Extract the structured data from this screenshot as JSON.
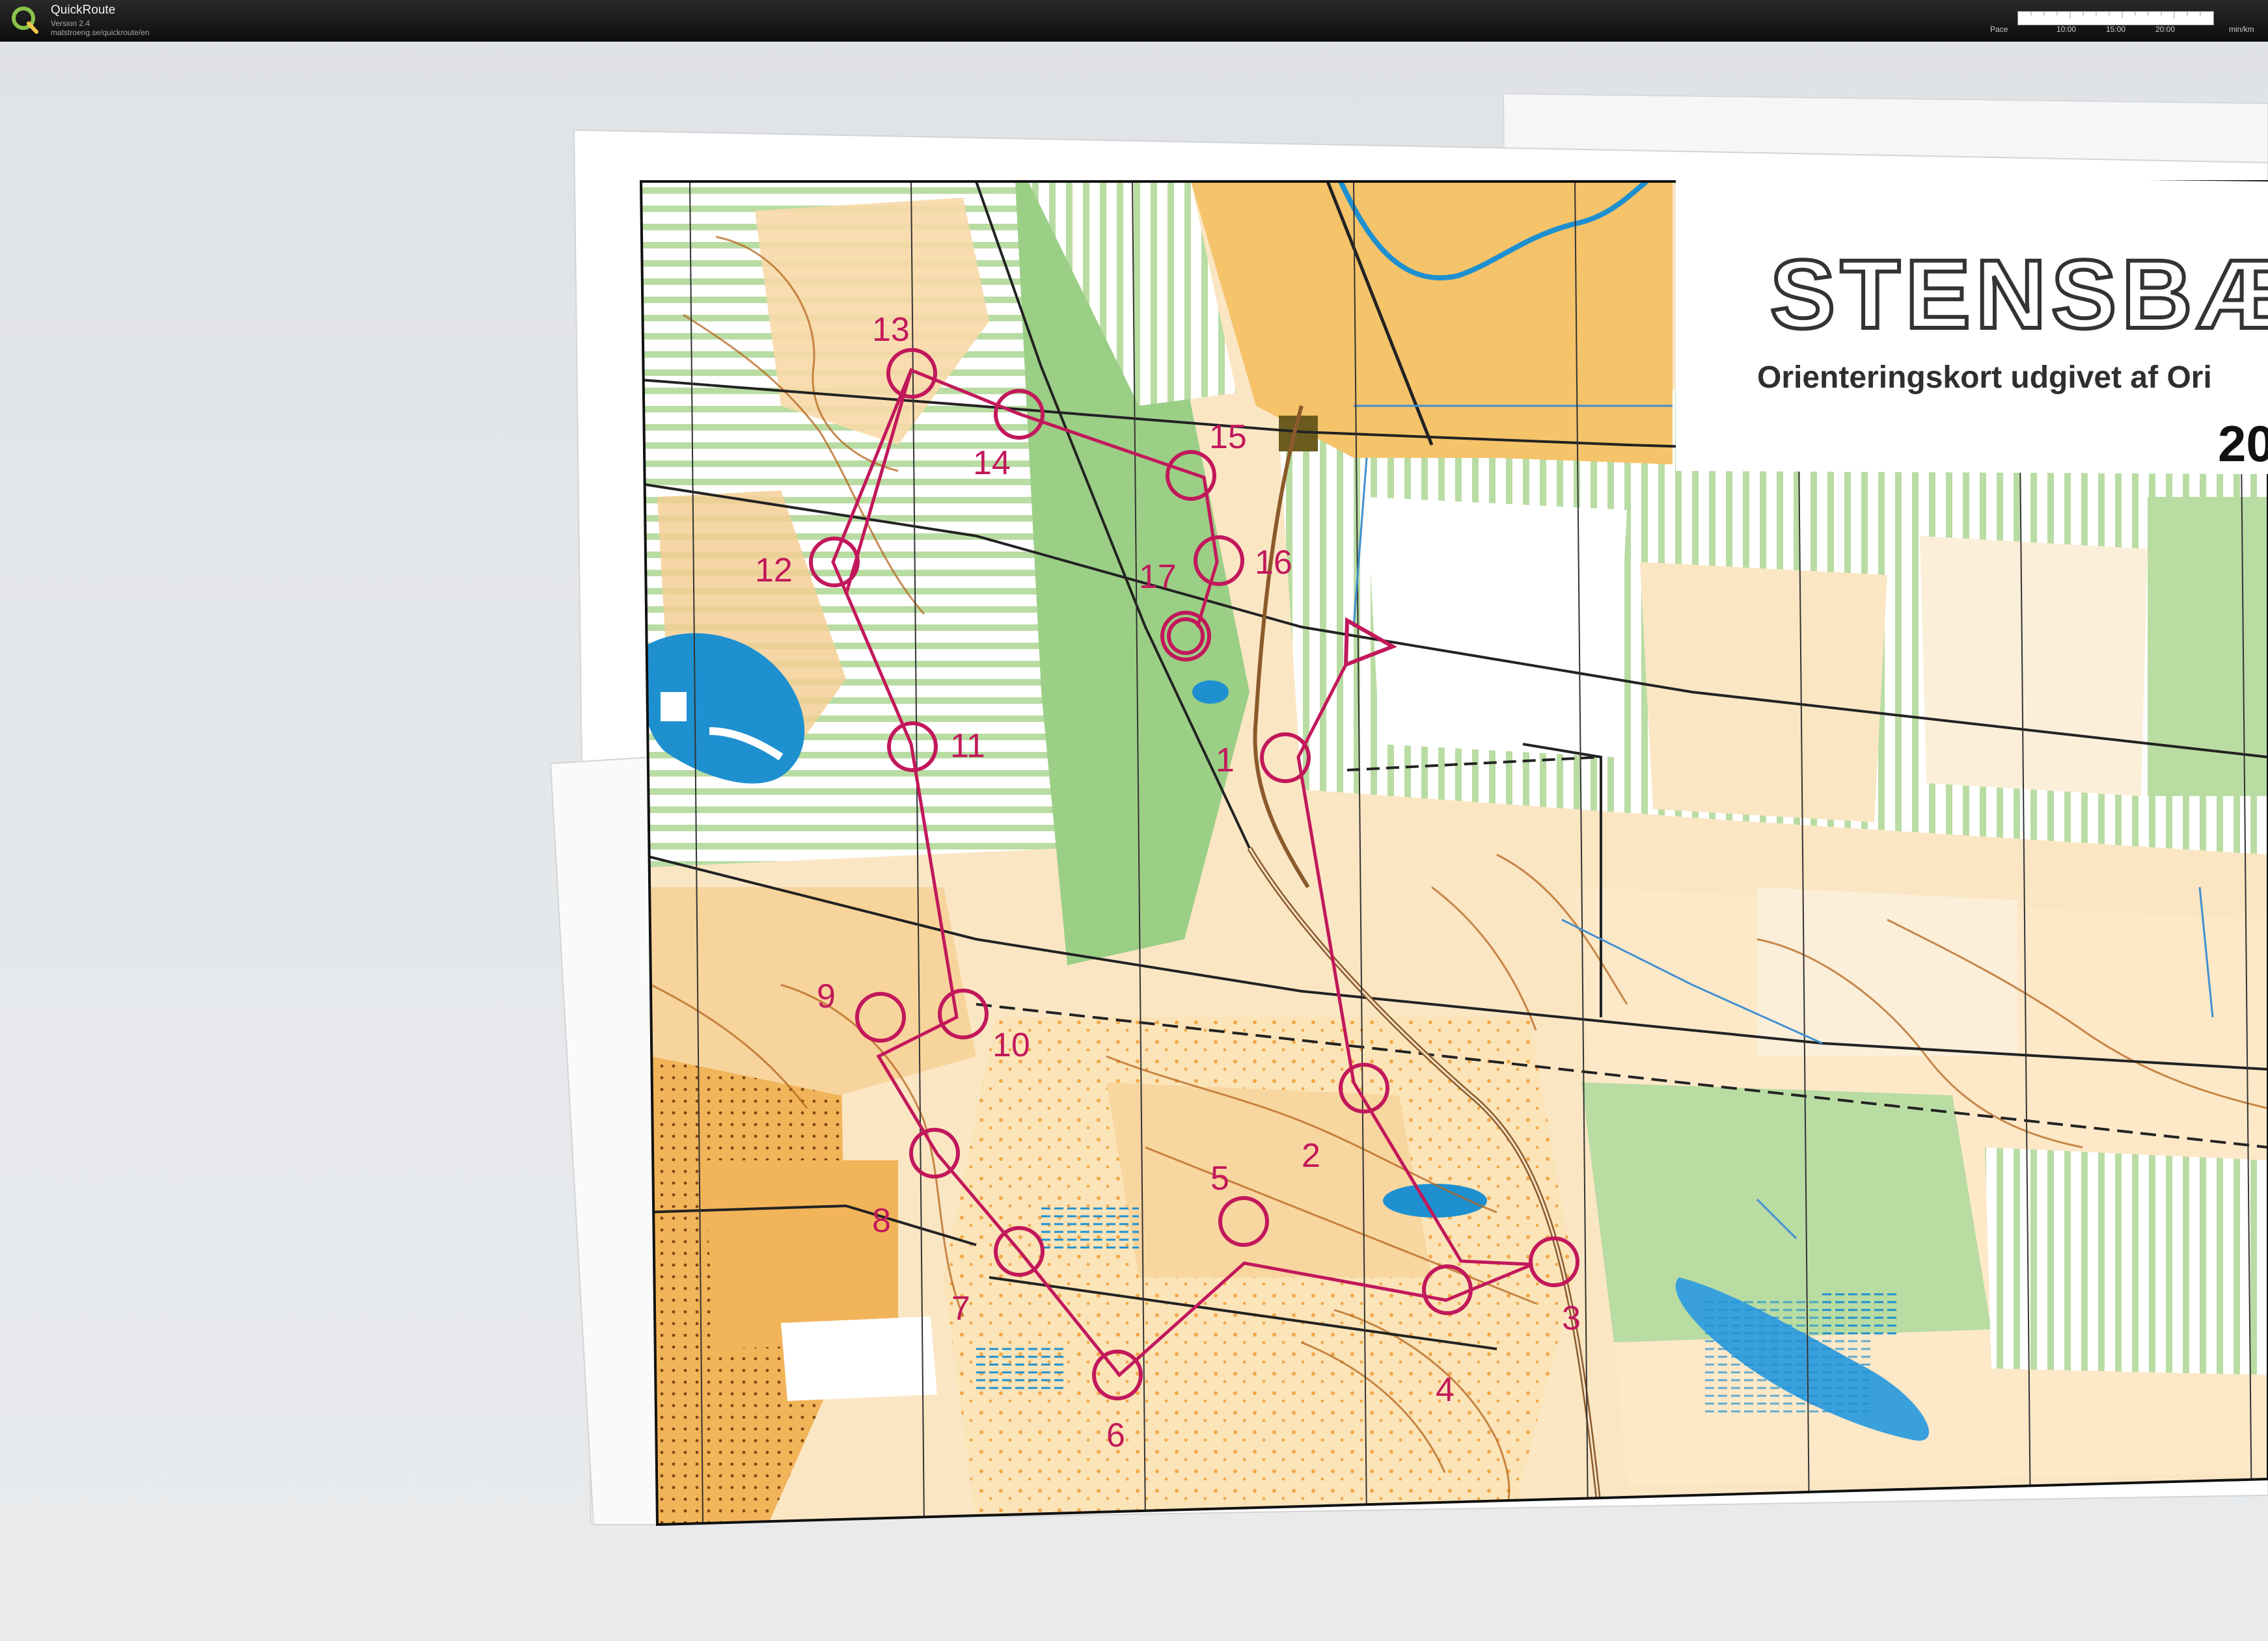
{
  "app": {
    "title": "QuickRoute",
    "version": "Version 2.4",
    "url": "matstroeng.se/quickroute/en",
    "logo_letter": "Q"
  },
  "pace_scale": {
    "label": "Pace",
    "ticks": [
      "10:00",
      "15:00",
      "20:00"
    ],
    "unit": "min/km"
  },
  "map": {
    "name_text": "STENSBÆ",
    "subtitle_text": "Orienteringskort udgivet af Ori",
    "year_text": "20",
    "controls": [
      "1",
      "2",
      "3",
      "4",
      "5",
      "6",
      "7",
      "8",
      "9",
      "10",
      "11",
      "12",
      "13",
      "14",
      "15",
      "16",
      "17"
    ],
    "colors": {
      "course": "#c2185b",
      "open_land": "#f7c76e",
      "rough_open": "#fbe4b8",
      "forest": "#ffffff",
      "green": "#b9dca3",
      "dark_green": "#7fbf6e",
      "water": "#1e90d0",
      "contour": "#b5651d"
    }
  }
}
